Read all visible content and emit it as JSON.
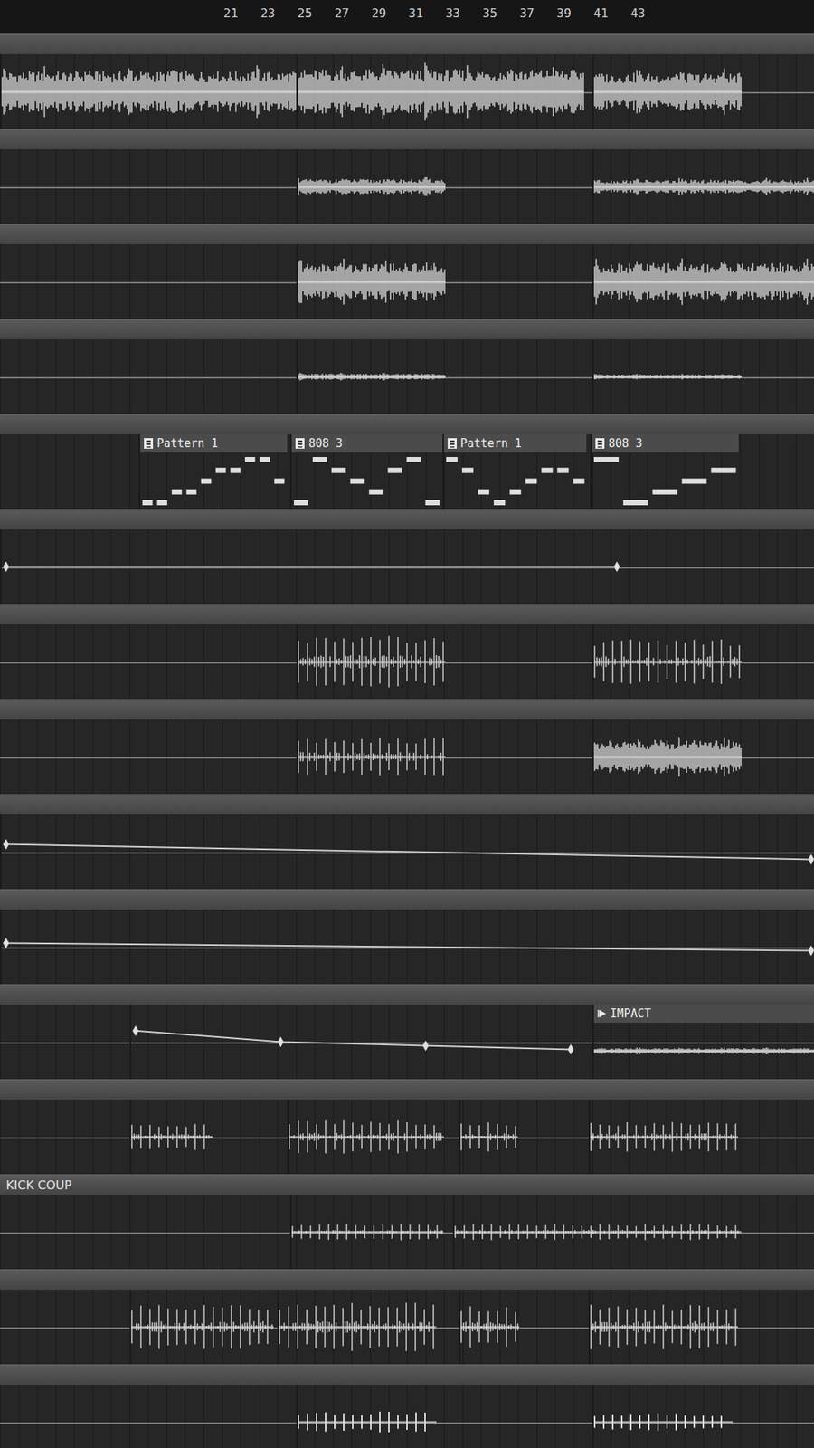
{
  "ruler": {
    "labels": [
      "21",
      "23",
      "25",
      "27",
      "29",
      "31",
      "33",
      "35",
      "37",
      "39",
      "41",
      "43"
    ]
  },
  "tracks": [
    {
      "name": "",
      "clips": [
        {
          "kind": "audio",
          "label": "",
          "start": 9,
          "length": 16,
          "level": 0.55,
          "style": "wave"
        },
        {
          "kind": "audio",
          "label": "",
          "start": 25,
          "length": 15.5,
          "level": 0.6,
          "style": "wave"
        },
        {
          "kind": "audio",
          "label": "",
          "start": 41,
          "length": 8,
          "level": 0.5,
          "style": "wave"
        }
      ]
    },
    {
      "name": "",
      "clips": [
        {
          "kind": "audio",
          "label": "",
          "start": 25,
          "length": 8,
          "level": 0.2,
          "style": "wave"
        },
        {
          "kind": "audio",
          "label": "",
          "start": 41,
          "length": 12,
          "level": 0.18,
          "style": "wave"
        }
      ]
    },
    {
      "name": "",
      "clips": [
        {
          "kind": "audio",
          "label": "",
          "start": 25,
          "length": 8,
          "level": 0.5,
          "style": "wave"
        },
        {
          "kind": "audio",
          "label": "",
          "start": 41,
          "length": 12,
          "level": 0.5,
          "style": "wave"
        }
      ]
    },
    {
      "name": "",
      "clips": [
        {
          "kind": "audio",
          "label": "",
          "start": 25,
          "length": 8,
          "level": 0.08,
          "style": "wave"
        },
        {
          "kind": "audio",
          "label": "",
          "start": 41,
          "length": 8,
          "level": 0.06,
          "style": "wave"
        }
      ]
    },
    {
      "name": "",
      "clips": [
        {
          "kind": "pattern",
          "label": "Pattern 1",
          "start": 16.5,
          "length": 8,
          "notes": [
            0,
            0,
            1,
            1,
            2,
            3,
            3,
            4,
            4,
            2
          ]
        },
        {
          "kind": "pattern",
          "label": "808 3",
          "start": 24.7,
          "length": 8.2,
          "notes": [
            0,
            4,
            3,
            2,
            1,
            3,
            4,
            0
          ]
        },
        {
          "kind": "pattern",
          "label": "Pattern 1",
          "start": 32.9,
          "length": 7.8,
          "notes": [
            4,
            3,
            1,
            0,
            1,
            2,
            3,
            3,
            2
          ]
        },
        {
          "kind": "pattern",
          "label": "808 3",
          "start": 40.9,
          "length": 8,
          "notes": [
            4,
            0,
            1,
            2,
            3
          ]
        }
      ]
    },
    {
      "name": "",
      "clips": [
        {
          "kind": "automation",
          "label": "",
          "start": 9,
          "length": 33.5,
          "points": [
            0.5,
            0.5
          ]
        }
      ]
    },
    {
      "name": "",
      "clips": [
        {
          "kind": "audio",
          "label": "",
          "start": 25,
          "length": 8,
          "level": 0.7,
          "style": "hits"
        },
        {
          "kind": "audio",
          "label": "",
          "start": 41,
          "length": 8,
          "level": 0.6,
          "style": "hits"
        }
      ]
    },
    {
      "name": "",
      "clips": [
        {
          "kind": "audio",
          "label": "",
          "start": 25,
          "length": 8,
          "level": 0.5,
          "style": "hits"
        },
        {
          "kind": "audio",
          "label": "",
          "start": 41,
          "length": 8,
          "level": 0.45,
          "style": "wave"
        }
      ]
    },
    {
      "name": "",
      "clips": [
        {
          "kind": "automation",
          "label": "",
          "start": 9,
          "length": 44,
          "points": [
            0.6,
            0.4
          ]
        }
      ]
    },
    {
      "name": "",
      "clips": [
        {
          "kind": "automation",
          "label": "",
          "start": 9,
          "length": 44,
          "points": [
            0.55,
            0.45
          ]
        }
      ]
    },
    {
      "name": "",
      "clips": [
        {
          "kind": "automation",
          "label": "",
          "start": 16,
          "length": 24,
          "points": [
            0.65,
            0.5,
            0.45,
            0.4
          ]
        },
        {
          "kind": "audio",
          "label": "IMPACT",
          "start": 41,
          "length": 12,
          "level": 0.1,
          "style": "wave"
        }
      ]
    },
    {
      "name": "",
      "clips": [
        {
          "kind": "audio",
          "label": "",
          "start": 16,
          "length": 4.4,
          "level": 0.35,
          "style": "hits"
        },
        {
          "kind": "audio",
          "label": "",
          "start": 24.5,
          "length": 8.4,
          "level": 0.45,
          "style": "hits"
        },
        {
          "kind": "audio",
          "label": "",
          "start": 33.8,
          "length": 3.1,
          "level": 0.4,
          "style": "hits"
        },
        {
          "kind": "audio",
          "label": "",
          "start": 40.8,
          "length": 8,
          "level": 0.4,
          "style": "hits"
        }
      ]
    },
    {
      "name": "KICK COUP",
      "clips": [
        {
          "kind": "audio",
          "label": "",
          "start": 24.7,
          "length": 8.2,
          "level": 0.22,
          "style": "hits"
        },
        {
          "kind": "audio",
          "label": "",
          "start": 33.5,
          "length": 15.5,
          "level": 0.22,
          "style": "hits"
        }
      ]
    },
    {
      "name": "",
      "clips": [
        {
          "kind": "audio",
          "label": "",
          "start": 16,
          "length": 7.7,
          "level": 0.6,
          "style": "hits"
        },
        {
          "kind": "audio",
          "label": "",
          "start": 24,
          "length": 8.5,
          "level": 0.65,
          "style": "hits"
        },
        {
          "kind": "audio",
          "label": "",
          "start": 33.8,
          "length": 3.2,
          "level": 0.55,
          "style": "hits"
        },
        {
          "kind": "audio",
          "label": "",
          "start": 40.8,
          "length": 8,
          "level": 0.6,
          "style": "hits"
        }
      ]
    },
    {
      "name": "",
      "clips": [
        {
          "kind": "audio",
          "label": "",
          "start": 25,
          "length": 7.5,
          "level": 0.35,
          "style": "ticks"
        },
        {
          "kind": "audio",
          "label": "",
          "start": 41,
          "length": 7.5,
          "level": 0.3,
          "style": "ticks"
        }
      ]
    }
  ]
}
